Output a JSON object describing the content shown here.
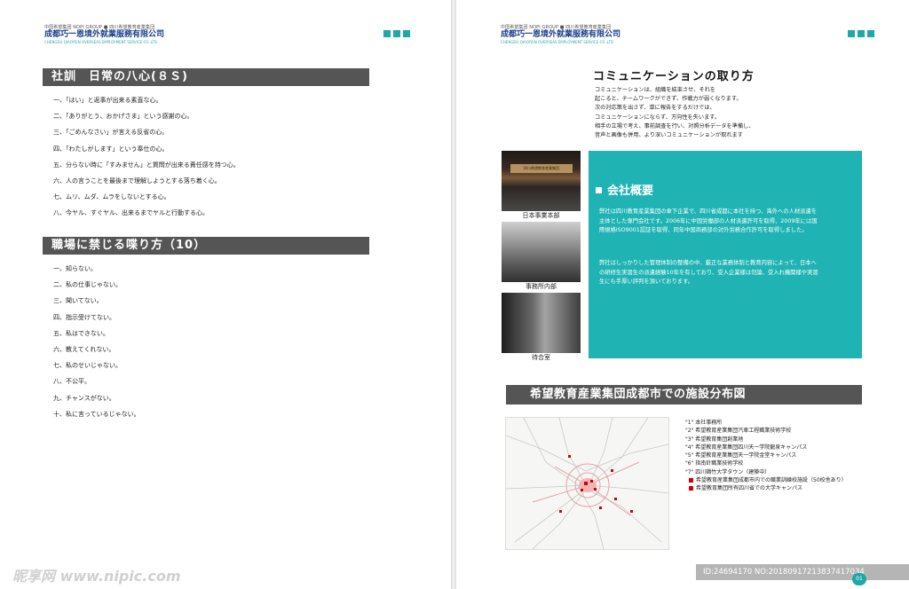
{
  "header": {
    "top_line": "中国希望集团 NOPI  GROUP ■ 四川希望教育産業集団",
    "company": "成都巧一恩境外就業服務有限公司",
    "english": "CHENGDU QIAOYIEN OVERSEAS EMPLOYMENT SERVICE CO.,LTD"
  },
  "left": {
    "section1_title": "社訓　日常の八心(８Ｓ)",
    "section1_items": [
      "一、「はい」と返事が出来る素直な心。",
      "二、「ありがとう、おかげさま」という感謝の心。",
      "三、「ごめんなさい」が言える反省の心。",
      "四、「わたしがします」という奉仕の心。",
      "五、分らない時に「すみません」と質問が出来る責任感を持つ心。",
      "六、人の言うことを最後まで理解しようとする落ち着く心。",
      "七、ムリ、ムダ、ムラをしないとする心。",
      "八、今ヤル、すぐヤル、出来るまでヤルと行動する心。"
    ],
    "section2_title": "職場に禁じる喋り方（10）",
    "section2_items": [
      "一、知らない。",
      "二、私の仕事じゃない。",
      "三、聞いてない。",
      "四、指示受けてない。",
      "五、私はできない。",
      "六、教えてくれない。",
      "七、私のせいじゃない。",
      "八、不公平。",
      "九、チャンスがない。",
      "十、私に言っているじゃない。"
    ],
    "watermark": "昵享网 www.nipic.com"
  },
  "right": {
    "comm_title": "コミュニケーションの取り方",
    "comm_lines": [
      "コミュニケーションは、組織を結束させ、それを",
      "起こると、チームワークができず、作戦力が弱くなります。",
      "次の対応策を出さず、単に報告をするだけでは、",
      "コミュニケーションにならず、方向性を失います。",
      "相手の立場で考え、事前調査を行い、対照分析データを準備し、",
      "音声と画像も併用、より深いコミュニケーションが取れます"
    ],
    "photo1_sign": "四川希望教育産業集団",
    "captions": [
      "日本事業本部",
      "事務所内部",
      "待合室"
    ],
    "overview_title": "会社概要",
    "overview_p1": "弊社は四川教育産業集団の傘下企業で、四川省成都に本社を持つ、海外への人材派遣を主体とした専門会社です。2006年に中国労働部の人材派遣許可を取得、2009年には国際規格ISO9001認証を取得、同年中国商務部の対外労務合作許可を取得しました。",
    "overview_p2": "弊社はしっかりした管理体制の整備の中、厳正な業務体制と教育内容によって、日本への研修生実習生の派遣経験10年を有しており、受入企業様は勿論、受入れ機関様や実習生にも手厚い評判を頂いております。",
    "map_title": "希望教育産業集団成都市での施設分布図",
    "legend": [
      "\"1\"  本社事務所",
      "\"2\"  希望教育産業集団汽車工程職業技術学校",
      "\"3\"  希望教育集団創業地",
      "\"4\"  希望教育産業集団四川天一学院龍泉キャンパス",
      "\"5\"  希望教育産業集団天一学院金堂キャンパス",
      "\"6\"  指南針職業技術学校",
      "\"7\"  四川鶏竹大学タウン（建築中）"
    ],
    "legend_marked": [
      "希望教育産業集団成都市内での職業訓練校施設（50校舎あり）",
      "希望教育集団所有四川省での大学キャンパス"
    ],
    "watermark": "ID:24694170 NO:20180917213837417034",
    "page_number": "01"
  },
  "colors": {
    "accent_teal": "#1fb3b3",
    "bar_gray": "#555555",
    "company_blue": "#1a3e8c",
    "map_marker": "#d40000"
  }
}
